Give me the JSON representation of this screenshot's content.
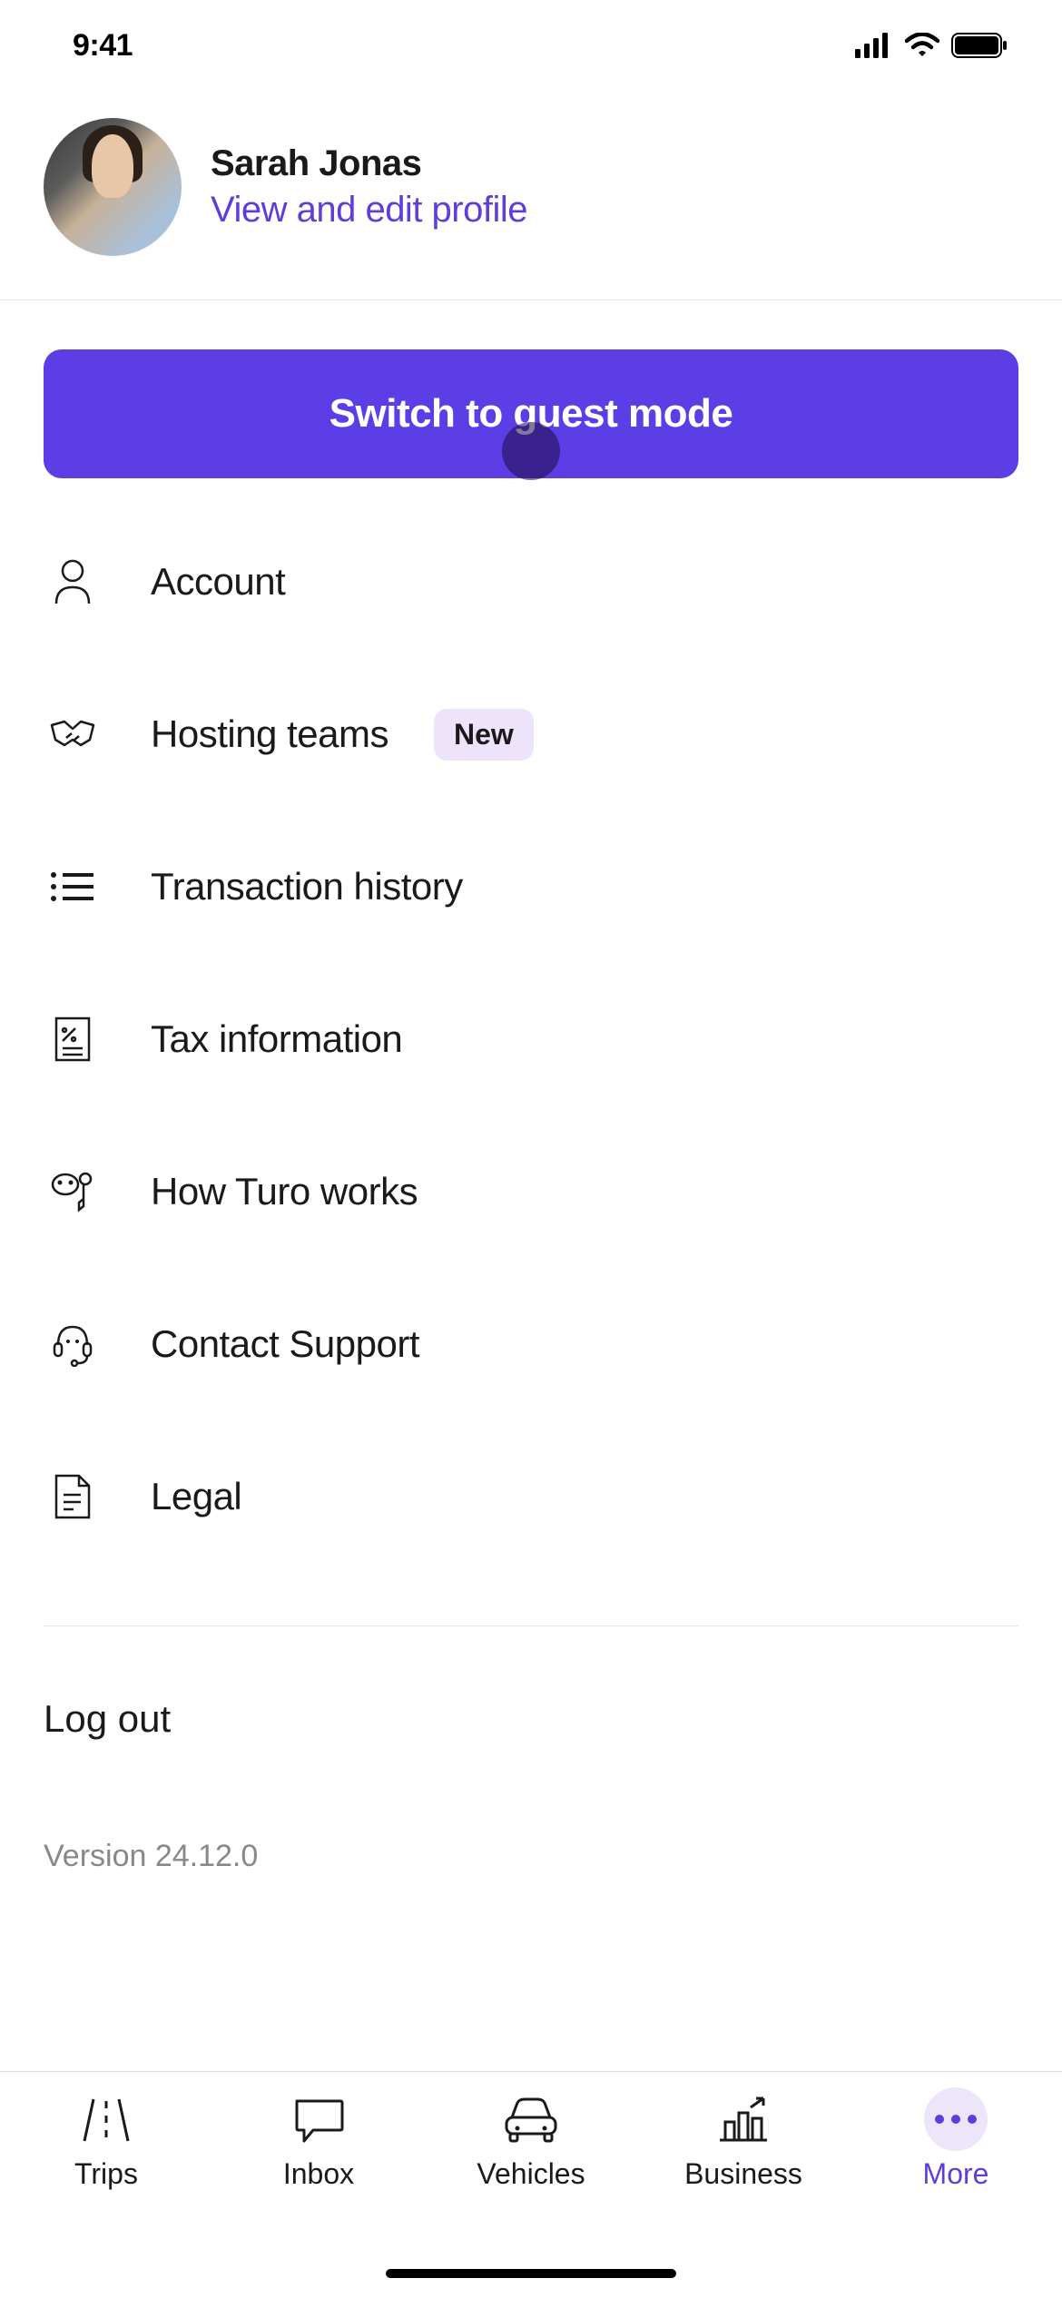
{
  "status": {
    "time": "9:41"
  },
  "profile": {
    "name": "Sarah Jonas",
    "view_edit": "View and edit profile"
  },
  "switch_button": "Switch to guest mode",
  "menu": {
    "account": "Account",
    "hosting": "Hosting teams",
    "hosting_badge": "New",
    "transactions": "Transaction history",
    "tax": "Tax information",
    "how": "How Turo works",
    "support": "Contact Support",
    "legal": "Legal"
  },
  "logout": "Log out",
  "version": "Version 24.12.0",
  "tabs": {
    "trips": "Trips",
    "inbox": "Inbox",
    "vehicles": "Vehicles",
    "business": "Business",
    "more": "More"
  },
  "colors": {
    "accent": "#5c3ee6",
    "link": "#5e3dd8",
    "badge_bg": "#ede3fa"
  }
}
